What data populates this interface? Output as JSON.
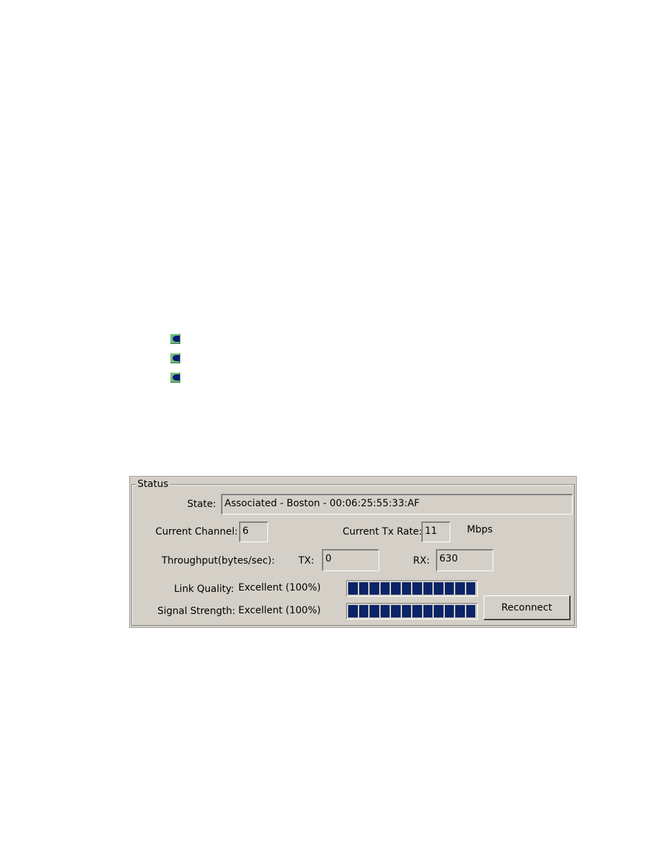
{
  "status_panel": {
    "group_title": "Status",
    "state": {
      "label": "State:",
      "value": "Associated - Boston - 00:06:25:55:33:AF"
    },
    "current_channel": {
      "label": "Current Channel:",
      "value": "6"
    },
    "current_tx_rate": {
      "label": "Current Tx Rate:",
      "value": "11",
      "unit": "Mbps"
    },
    "throughput": {
      "label": "Throughput(bytes/sec):",
      "tx_label": "TX:",
      "tx_value": "0",
      "rx_label": "RX:",
      "rx_value": "630"
    },
    "link_quality": {
      "label": "Link Quality:",
      "value": "Excellent (100%)",
      "level": 1.0
    },
    "signal_strength": {
      "label": "Signal Strength:",
      "value": "Excellent (100%)",
      "level": 1.0
    },
    "reconnect_label": "Reconnect"
  },
  "colors": {
    "panel_bg": "#d4d0c8",
    "bar_fill": "#0a2468",
    "bullet_green": "#6fbd7a",
    "bullet_blue": "#0a1a7a"
  },
  "icons": [
    "bullet-icon",
    "bullet-icon",
    "bullet-icon"
  ]
}
